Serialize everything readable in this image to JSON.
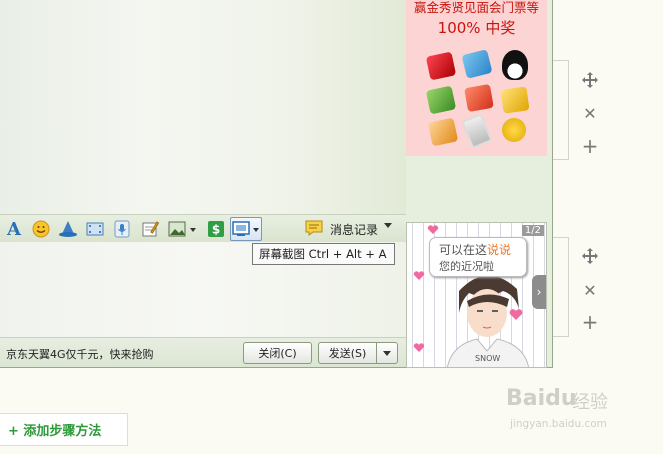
{
  "toolbar": {
    "message_record_label": "消息记录"
  },
  "tooltip": {
    "text": "屏幕截图 Ctrl + Alt + A"
  },
  "bottombar": {
    "promo_text": "京东天翼4G仅千元，快来抢购",
    "close_label": "关闭(C)",
    "send_label": "发送(S)"
  },
  "ad": {
    "line1": "赢金秀贤见面会门票等",
    "line2": "100% 中奖"
  },
  "show": {
    "page_indicator": "1/2",
    "bubble_prefix": "可以在这",
    "bubble_highlight": "说说",
    "bubble_line2": "您的近况啦"
  },
  "page": {
    "add_step_label": "+ 添加步骤方法"
  },
  "watermark": {
    "brand": "Baidu",
    "brand_cn": "经验",
    "url": "jingyan.baidu.com"
  },
  "colors": {
    "ad_red": "#c8140d",
    "chat_bg": "#e6eedd",
    "add_green": "#2d9a3a"
  }
}
